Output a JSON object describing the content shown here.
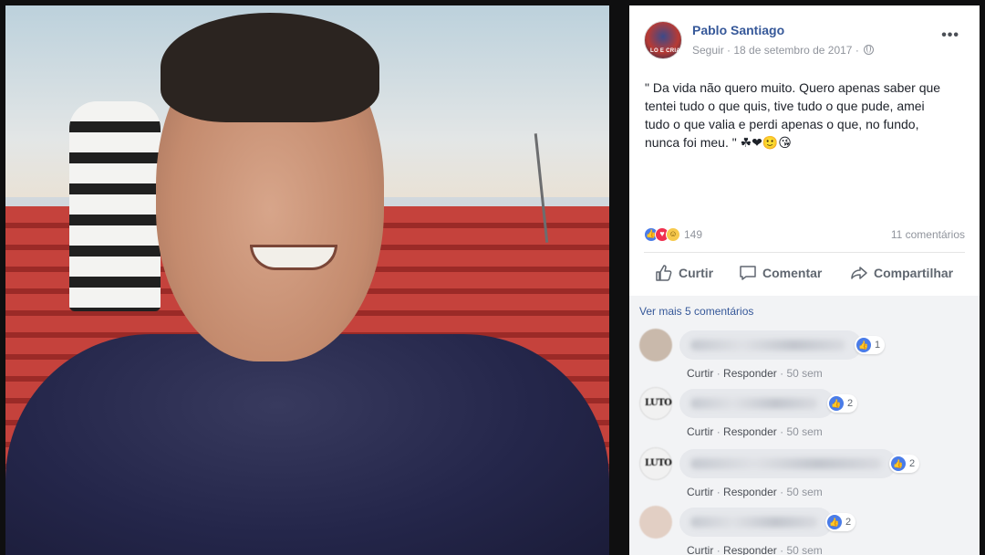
{
  "post": {
    "author": "Pablo Santiago",
    "follow": "Seguir",
    "date": "18 de setembro de 2017",
    "meta_separator": "·",
    "avatar_caption": "LO E CRIA",
    "more_label": "•••",
    "text_line1": "\" Da vida não quero muito. Quero apenas saber que",
    "text_line2": "tentei tudo o que quis, tive tudo o que pude, amei",
    "text_line3": "tudo o que valia e perdi apenas o que, no fundo,",
    "text_line4": "nunca foi meu. \"",
    "emojis": "☘❤🙂😘"
  },
  "reactions": {
    "count": "149",
    "comments_count": "11 comentários",
    "icon_names": [
      "like-icon",
      "love-icon",
      "haha-icon"
    ]
  },
  "actions": {
    "like": "Curtir",
    "comment": "Comentar",
    "share": "Compartilhar"
  },
  "comments_section": {
    "see_more": "Ver mais 5 comentários",
    "reply_label": "Responder",
    "like_label": "Curtir",
    "separator": "·",
    "items": [
      {
        "likes": "1",
        "time": "50 sem",
        "avatar_text": ""
      },
      {
        "likes": "2",
        "time": "50 sem",
        "avatar_text": "LUTO"
      },
      {
        "likes": "2",
        "time": "50 sem",
        "avatar_text": "LUTO"
      },
      {
        "likes": "2",
        "time": "50 sem",
        "avatar_text": ""
      }
    ]
  },
  "colors": {
    "link_blue": "#365899",
    "meta_gray": "#90949c",
    "like_blue": "#4a7ce8",
    "love_red": "#f0304f",
    "comments_bg": "#f2f3f5"
  }
}
